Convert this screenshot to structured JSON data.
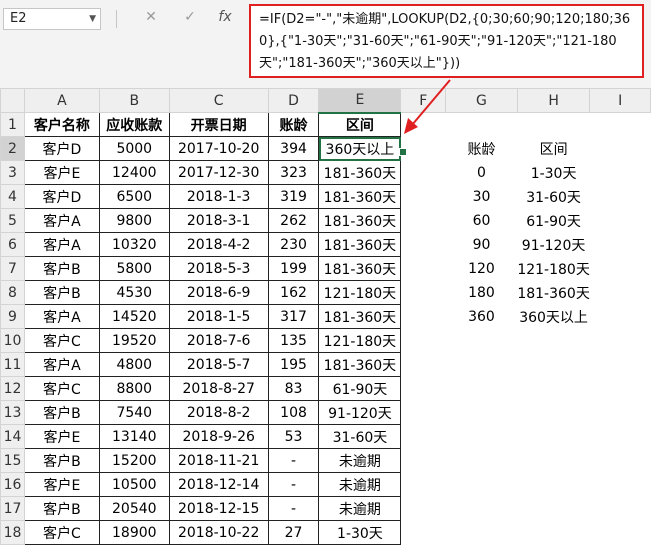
{
  "name_box": "E2",
  "formula_bar": {
    "cancel_glyph": "✕",
    "enter_glyph": "✓",
    "fx_label": "fx",
    "formula": "=IF(D2=\"-\",\"未逾期\",LOOKUP(D2,{0;30;60;90;120;180;360},{\"1-30天\";\"31-60天\";\"61-90天\";\"91-120天\";\"121-180天\";\"181-360天\";\"360天以上\"}))"
  },
  "columns": [
    "A",
    "B",
    "C",
    "D",
    "E",
    "F",
    "G",
    "H",
    "I"
  ],
  "rows": [
    "1",
    "2",
    "3",
    "4",
    "5",
    "6",
    "7",
    "8",
    "9",
    "10",
    "11",
    "12",
    "13",
    "14",
    "15",
    "16",
    "17",
    "18"
  ],
  "table": {
    "headers": [
      "客户名称",
      "应收账款",
      "开票日期",
      "账龄",
      "区间"
    ],
    "records": [
      [
        "客户D",
        "5000",
        "2017-10-20",
        "394",
        "360天以上"
      ],
      [
        "客户E",
        "12400",
        "2017-12-30",
        "323",
        "181-360天"
      ],
      [
        "客户D",
        "6500",
        "2018-1-3",
        "319",
        "181-360天"
      ],
      [
        "客户A",
        "9800",
        "2018-3-1",
        "262",
        "181-360天"
      ],
      [
        "客户A",
        "10320",
        "2018-4-2",
        "230",
        "181-360天"
      ],
      [
        "客户B",
        "5800",
        "2018-5-3",
        "199",
        "181-360天"
      ],
      [
        "客户B",
        "4530",
        "2018-6-9",
        "162",
        "121-180天"
      ],
      [
        "客户A",
        "14520",
        "2018-1-5",
        "317",
        "181-360天"
      ],
      [
        "客户C",
        "19520",
        "2018-7-6",
        "135",
        "121-180天"
      ],
      [
        "客户A",
        "4800",
        "2018-5-7",
        "195",
        "181-360天"
      ],
      [
        "客户C",
        "8800",
        "2018-8-27",
        "83",
        "61-90天"
      ],
      [
        "客户B",
        "7540",
        "2018-8-2",
        "108",
        "91-120天"
      ],
      [
        "客户E",
        "13140",
        "2018-9-26",
        "53",
        "31-60天"
      ],
      [
        "客户B",
        "15200",
        "2018-11-21",
        "-",
        "未逾期"
      ],
      [
        "客户E",
        "10500",
        "2018-12-14",
        "-",
        "未逾期"
      ],
      [
        "客户B",
        "20540",
        "2018-12-15",
        "-",
        "未逾期"
      ],
      [
        "客户C",
        "18900",
        "2018-10-22",
        "27",
        "1-30天"
      ]
    ]
  },
  "lookup_table": {
    "headers": [
      "账龄",
      "区间"
    ],
    "records": [
      [
        "0",
        "1-30天"
      ],
      [
        "30",
        "31-60天"
      ],
      [
        "60",
        "61-90天"
      ],
      [
        "90",
        "91-120天"
      ],
      [
        "120",
        "121-180天"
      ],
      [
        "180",
        "181-360天"
      ],
      [
        "360",
        "360天以上"
      ]
    ]
  },
  "colors": {
    "accent": "#217346",
    "annotation": "#e02020"
  }
}
